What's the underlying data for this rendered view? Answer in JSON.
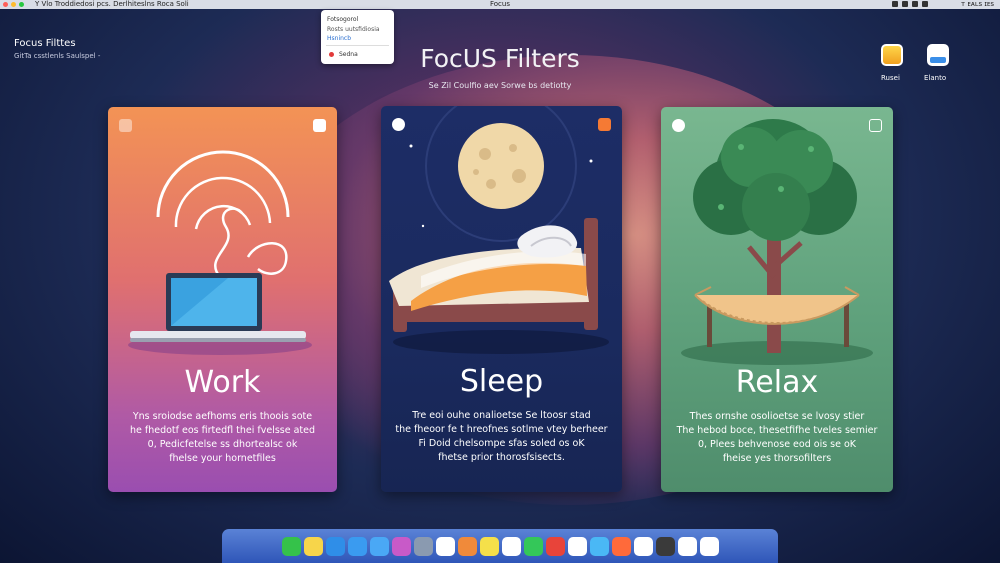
{
  "menubar": {
    "left_text": "Y Vlo  Troddiedosi pcs. Derlhiteslns Roca Soli",
    "center_title": "Focus",
    "clock": "ᴛ ᴇᴀʟs ɪᴇs"
  },
  "popup": {
    "line1": "Fotsogorol",
    "line2": "Rosts uutsfidiosia",
    "line3": "Hsnincb",
    "line4": "Sedna"
  },
  "top_left": {
    "title": "Focus Filttes",
    "subtitle": "GitTa csstlenls Saulspel  -"
  },
  "header": {
    "title": "FocUS Filters",
    "subtitle": "Se Zil Coulfio  aev Sorwe bs detiotty"
  },
  "top_right": [
    {
      "label": "Rusei",
      "icon": "notes-icon"
    },
    {
      "label": "Elanto",
      "icon": "window-icon"
    }
  ],
  "cards": [
    {
      "key": "work",
      "title": "Work",
      "desc": [
        "Yns sroiodse aefhoms eris thoois sote",
        "he fhedotf eos firtedfl thei fvelsse ated",
        "0, Pedicfetelse ss dhortealsc ok",
        "fhelse your hornetfiles"
      ]
    },
    {
      "key": "sleep",
      "title": "Sleep",
      "desc": [
        "Tre eoi ouhe onalioetse  Se ltoosr stad",
        "the fheoor fe t hreofnes sotlme vtey berheer",
        "Fi  Doid  chelsompe sfas soled os  oK",
        "fhetse prior thorosfsisects."
      ]
    },
    {
      "key": "relax",
      "title": "Relax",
      "desc": [
        "Thes ornshe osolioetse  se lvosy stier",
        "The hebod boce, thesetfifhe tveles semier",
        "0, Plees behvenose eod ois se oK",
        "fheise yes thorsofilters"
      ]
    }
  ],
  "dock": {
    "colors": [
      "#35c24a",
      "#f7d54a",
      "#2f8ee8",
      "#3a9bf0",
      "#4aa8f5",
      "#c85ac8",
      "#8a9ab0",
      "#ffffff",
      "#f08a3a",
      "#f5e04a",
      "#ffffff",
      "#34c759",
      "#e8443a",
      "#ffffff",
      "#4ab8f5",
      "#ff6a3a",
      "#ffffff",
      "#3a3a3a",
      "#ffffff",
      "#ffffff"
    ],
    "icons": [
      "messages-icon",
      "notes-icon",
      "safari-icon",
      "finder-icon",
      "mail-icon",
      "podcasts-icon",
      "preview-icon",
      "files-icon",
      "calendar-icon",
      "stickies-icon",
      "reminders-icon",
      "facetime-icon",
      "news-icon",
      "photos-icon",
      "maps-icon",
      "music-icon",
      "contacts-icon",
      "camera-icon",
      "textedit-icon",
      "pages-icon"
    ]
  }
}
